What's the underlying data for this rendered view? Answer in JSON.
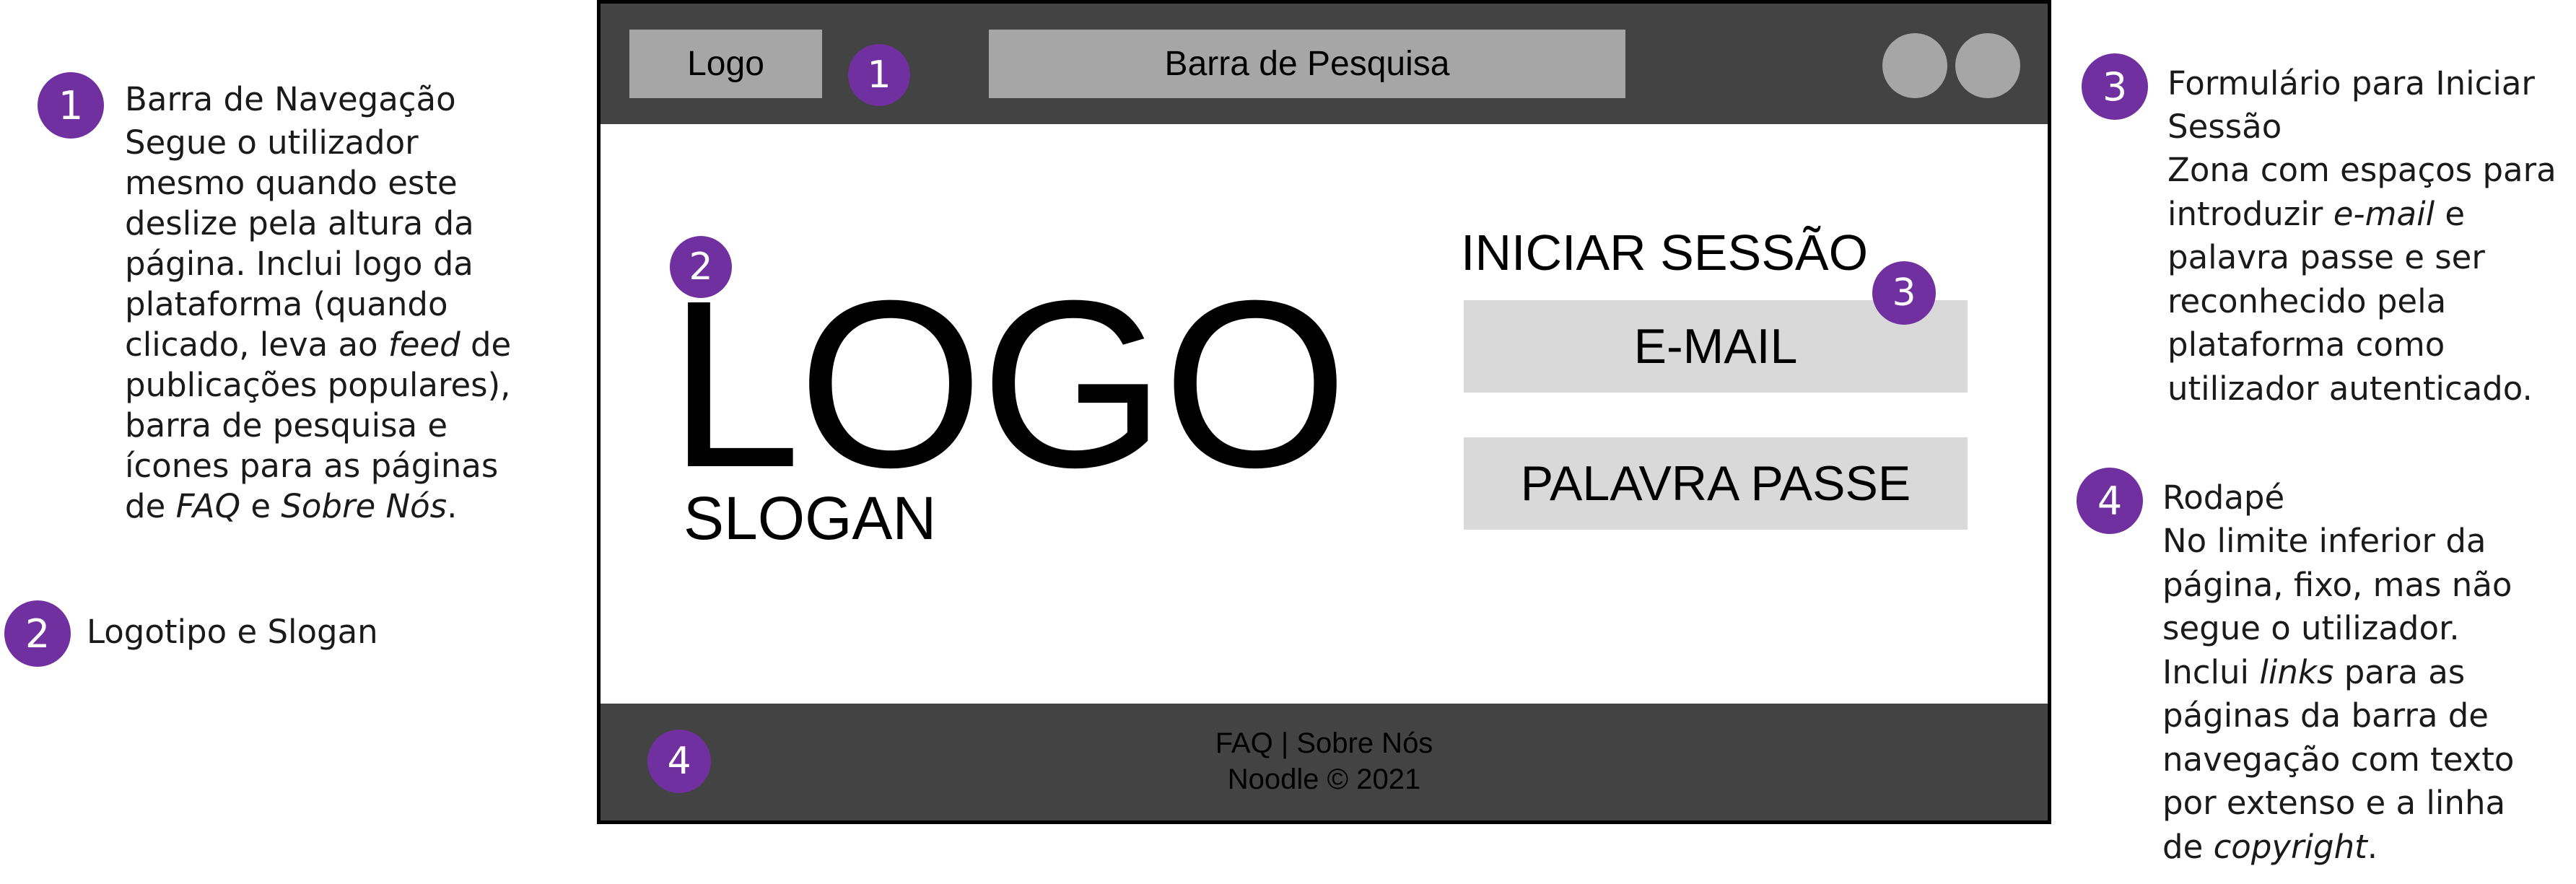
{
  "colors": {
    "badge": "#7030a0",
    "bar": "#434343",
    "box": "#a6a6a6",
    "field": "#d9d9d9"
  },
  "annotations": [
    {
      "number": "1",
      "title": "Barra de Navegação",
      "lines": [
        "Segue o utilizador",
        "mesmo quando este",
        "deslize pela altura da",
        "página. Inclui logo da",
        "plataforma (quando",
        "clicado, leva ao feed de",
        "publicações populares),",
        "barra de pesquisa e",
        "ícones para as páginas",
        "de FAQ e Sobre Nós."
      ]
    },
    {
      "number": "2",
      "title": "Logotipo e Slogan",
      "lines": []
    },
    {
      "number": "3",
      "title_lines": [
        "Formulário para Iniciar",
        "Sessão"
      ],
      "lines": [
        "Zona com espaços para",
        "introduzir e-mail e",
        "palavra passe e ser",
        "reconhecido pela",
        "plataforma como",
        "utilizador autenticado."
      ]
    },
    {
      "number": "4",
      "title": "Rodapé",
      "lines": [
        "No limite inferior da",
        "página, fixo, mas não",
        "segue o utilizador.",
        "Inclui links para as",
        "páginas da barra de",
        "navegação com texto",
        "por extenso e a linha",
        "de copyright."
      ]
    }
  ],
  "wireframe": {
    "header": {
      "logo_label": "Logo",
      "search_label": "Barra de Pesquisa",
      "badge": "1"
    },
    "main": {
      "logo_text": "LOGO",
      "slogan_text": "SLOGAN",
      "logo_badge": "2",
      "login_title": "INICIAR SESSÃO",
      "login_badge": "3",
      "email_label": "E-MAIL",
      "password_label": "PALAVRA PASSE"
    },
    "footer": {
      "links": "FAQ | Sobre Nós",
      "copyright": "Noodle © 2021",
      "badge": "4"
    }
  }
}
